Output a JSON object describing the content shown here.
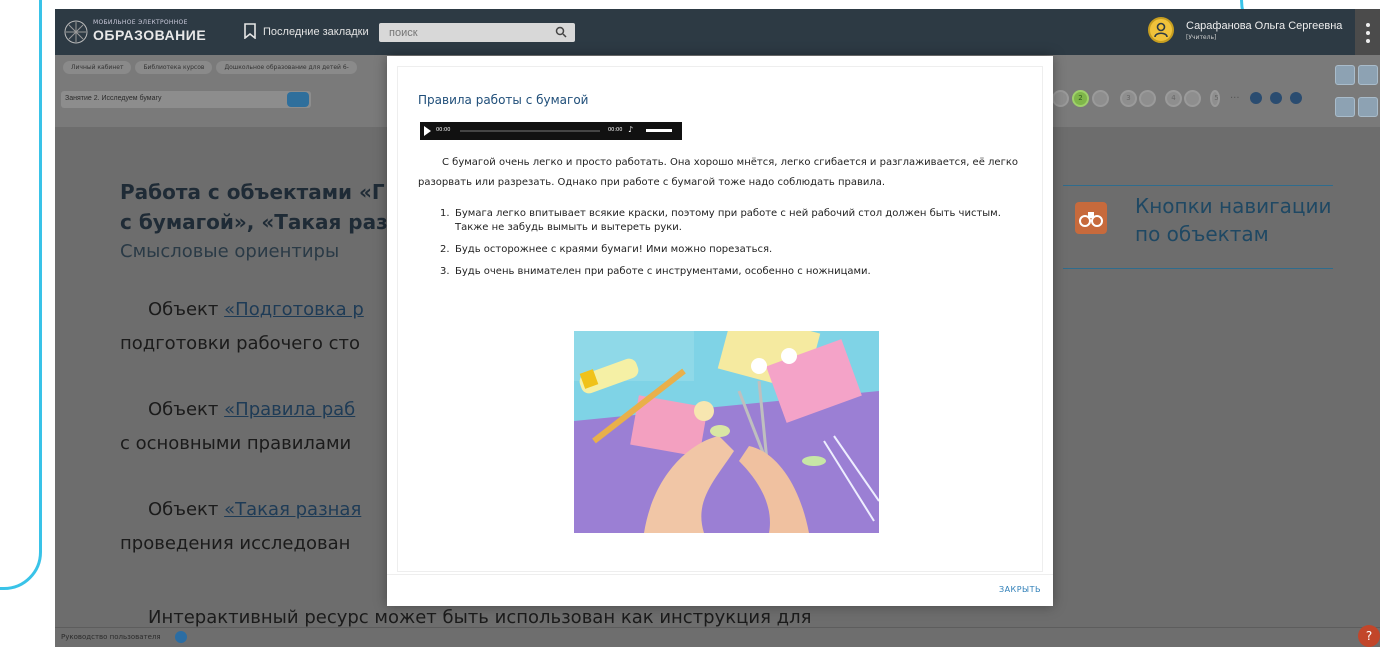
{
  "header": {
    "logo_line1": "Мобильное электронное",
    "logo_line2": "ОБРАЗОВАНИЕ",
    "bookmarks_label": "Последние закладки",
    "search_placeholder": "поиск",
    "user_name": "Сарафанова Ольга Сергеевна",
    "user_role": "[Учитель]"
  },
  "breadcrumbs": [
    "Личный кабинет",
    "Библиотека курсов",
    "Дошкольное образование для детей 6-"
  ],
  "lesson_select": "Занятие 2. Исследуем бумагу",
  "pager": {
    "pages": [
      "2",
      "3",
      "4",
      "5"
    ],
    "active": "2",
    "ellipsis": "..."
  },
  "content": {
    "heading_line1": "Работа с объектами «Г",
    "heading_line2": "с бумагой», «Такая раз",
    "subheading": "Смысловые ориентиры",
    "p1_prefix": "Объект ",
    "p1_link": "«Подготовка р",
    "p1_line2": "подготовки рабочего сто",
    "p2_prefix": "Объект ",
    "p2_link": "«Правила раб",
    "p2_line2": "с основными правилами",
    "p3_prefix": "Объект ",
    "p3_link": "«Такая разная",
    "p3_line2": "проведения исследован",
    "p4": "Интерактивный ресурс может быть использован как инструкция для"
  },
  "nav_card": {
    "line1": "Кнопки навигации",
    "line2": "по объектам"
  },
  "footer": {
    "guide": "Руководство пользователя",
    "help": "?"
  },
  "modal": {
    "title": "Правила работы с бумагой",
    "audio_time_current": "00:00",
    "audio_time_total": "00:00",
    "intro": "С бумагой очень легко и просто работать. Она хорошо мнётся, легко сгибается и разглаживается, её легко разорвать или разрезать. Однако при работе с бумагой тоже надо соблюдать правила.",
    "rules": [
      "Бумага легко впитывает всякие краски, поэтому при работе с ней рабочий стол должен быть чистым. Также не забудь вымыть и вытереть руки.",
      "Будь осторожнее с краями бумаги! Ими можно порезаться.",
      "Будь очень внимателен при работе с инструментами, особенно с ножницами."
    ],
    "close_label": "ЗАКРЫТЬ"
  },
  "colors": {
    "accent": "#2f7fb8",
    "topbar": "#2d3a44",
    "overlay_bg": "#6d6d6d",
    "decor": "#39c3e8"
  }
}
